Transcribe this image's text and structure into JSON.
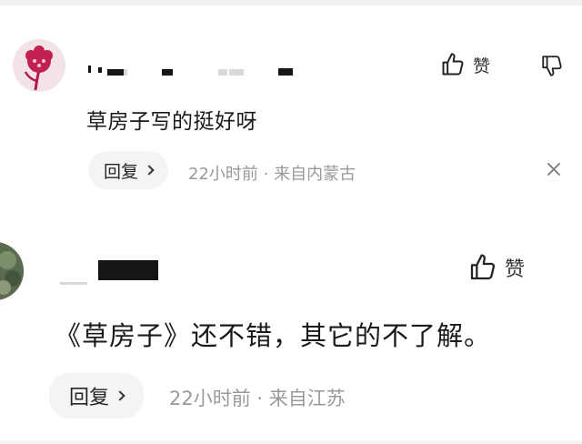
{
  "comments": [
    {
      "avatar": "user-avatar",
      "like_label": "赞",
      "text": "草房子写的挺好呀",
      "reply_label": "回复",
      "time": "22小时前",
      "separator": "·",
      "location": "来自内蒙古",
      "icons": [
        "thumbs-up-icon",
        "thumbs-down-icon",
        "close-icon",
        "chevron-right-icon"
      ]
    },
    {
      "avatar": "user-avatar",
      "like_label": "赞",
      "text": "《草房子》还不错，其它的不了解。",
      "reply_label": "回复",
      "time": "22小时前",
      "separator": "·",
      "location": "来自江苏",
      "icons": [
        "thumbs-up-icon",
        "chevron-right-icon"
      ]
    }
  ],
  "colors": {
    "meta_text": "#999999",
    "reply_bg": "#f4f4f4",
    "avatar_accent": "#c21f52"
  }
}
